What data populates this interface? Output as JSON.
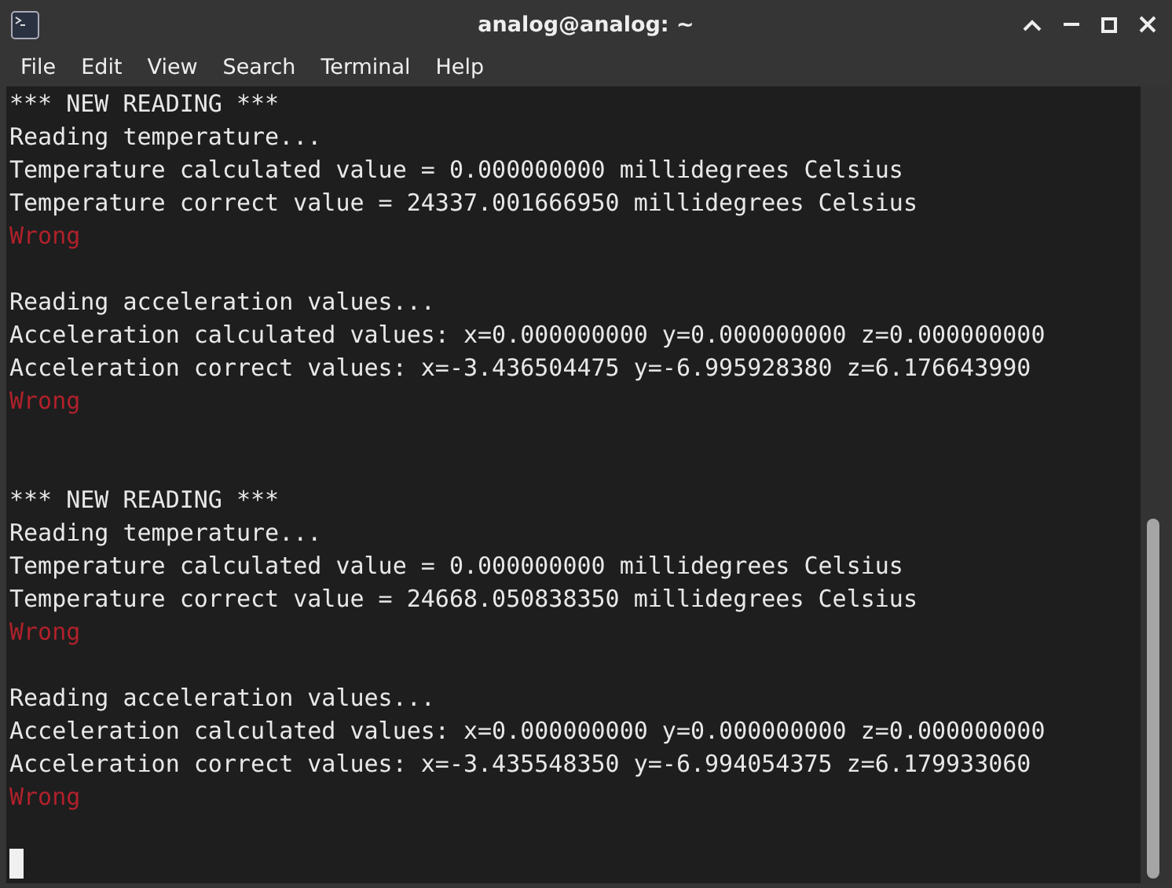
{
  "window": {
    "title": "analog@analog: ~"
  },
  "menu": [
    "File",
    "Edit",
    "View",
    "Search",
    "Terminal",
    "Help"
  ],
  "terminal": {
    "lines": [
      {
        "kind": "output",
        "text": "*** NEW READING ***"
      },
      {
        "kind": "output",
        "text": "Reading temperature..."
      },
      {
        "kind": "output",
        "text": "Temperature calculated value = 0.000000000 millidegrees Celsius"
      },
      {
        "kind": "output",
        "text": "Temperature correct value = 24337.001666950 millidegrees Celsius"
      },
      {
        "kind": "error",
        "text": "Wrong"
      },
      {
        "kind": "blank"
      },
      {
        "kind": "output",
        "text": "Reading acceleration values..."
      },
      {
        "kind": "output",
        "text": "Acceleration calculated values: x=0.000000000 y=0.000000000 z=0.000000000"
      },
      {
        "kind": "output",
        "text": "Acceleration correct values: x=-3.436504475 y=-6.995928380 z=6.176643990"
      },
      {
        "kind": "error",
        "text": "Wrong"
      },
      {
        "kind": "blank"
      },
      {
        "kind": "blank"
      },
      {
        "kind": "output",
        "text": "*** NEW READING ***"
      },
      {
        "kind": "output",
        "text": "Reading temperature..."
      },
      {
        "kind": "output",
        "text": "Temperature calculated value = 0.000000000 millidegrees Celsius"
      },
      {
        "kind": "output",
        "text": "Temperature correct value = 24668.050838350 millidegrees Celsius"
      },
      {
        "kind": "error",
        "text": "Wrong"
      },
      {
        "kind": "blank"
      },
      {
        "kind": "output",
        "text": "Reading acceleration values..."
      },
      {
        "kind": "output",
        "text": "Acceleration calculated values: x=0.000000000 y=0.000000000 z=0.000000000"
      },
      {
        "kind": "output",
        "text": "Acceleration correct values: x=-3.435548350 y=-6.994054375 z=6.179933060"
      },
      {
        "kind": "error",
        "text": "Wrong"
      },
      {
        "kind": "blank"
      },
      {
        "kind": "cursor"
      }
    ]
  }
}
